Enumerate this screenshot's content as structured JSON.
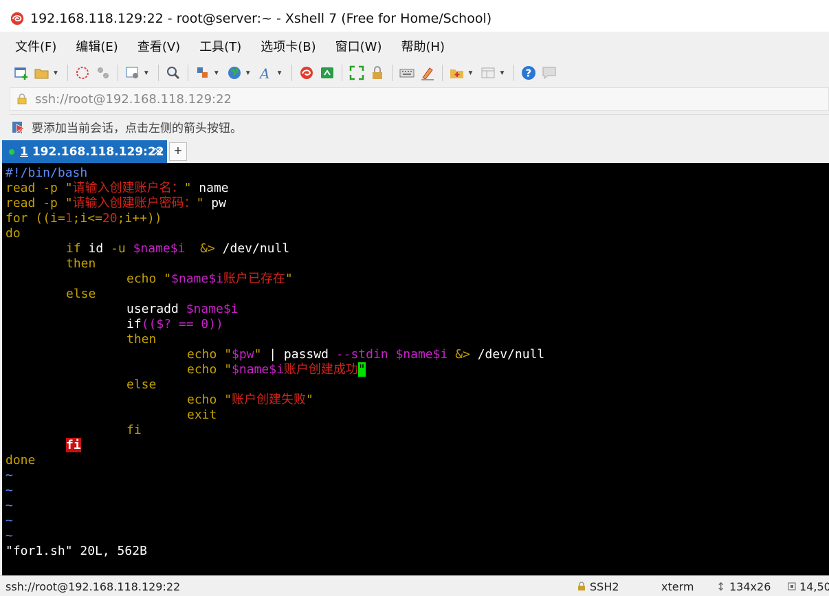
{
  "window": {
    "title": "192.168.118.129:22 - root@server:~ - Xshell 7 (Free for Home/School)"
  },
  "menu": [
    "文件(F)",
    "编辑(E)",
    "查看(V)",
    "工具(T)",
    "选项卡(B)",
    "窗口(W)",
    "帮助(H)"
  ],
  "address": {
    "value": "ssh://root@192.168.118.129:22"
  },
  "hint": {
    "text": "要添加当前会话，点击左侧的箭头按钮。"
  },
  "tab": {
    "num": "1",
    "label": "192.168.118.129:22",
    "close": "×",
    "add": "+"
  },
  "terminal": {
    "l1": "#!/bin/bash",
    "read": "read",
    "opt_p": "-p",
    "quote": "\"",
    "prompt1": "请输入创建账户名：",
    "var_name": "name",
    "prompt2": "请输入创建账户密码：",
    "var_pw": "pw",
    "for": "for",
    "for_open": " ((i=",
    "one": "1",
    "semi1": ";i<=",
    "twenty": "20",
    "for_close": ";i++))",
    "do": "do",
    "if": "if",
    "id_cmd": " id ",
    "opt_u": "-u",
    "nvar": "$name$i",
    "redir": "&>",
    "devnull": " /dev/null",
    "then": "then",
    "echo": "echo",
    "exists": "账户已存在",
    "else": "else",
    "useradd": "useradd ",
    "if2": "if",
    "paren_expr": "(($? == 0))",
    "pwvar": "$pw",
    "pipe_passwd": " | passwd ",
    "stdin": "--stdin",
    "success": "账户创建成功",
    "fail": "账户创建失败",
    "exit": "exit",
    "fi": "fi",
    "done": "done",
    "tilde": "~",
    "fileinfo": "\"for1.sh\" 20L, 562B"
  },
  "status": {
    "conn": "ssh://root@192.168.118.129:22",
    "proto": "SSH2",
    "term": "xterm",
    "size": "134x26",
    "pos": "14,50"
  },
  "colors": {
    "tab_active": "#1c6fc0",
    "cursor": "#00e000",
    "keyword": "#c4a000",
    "string": "#d0241b",
    "variable": "#c822c8"
  }
}
